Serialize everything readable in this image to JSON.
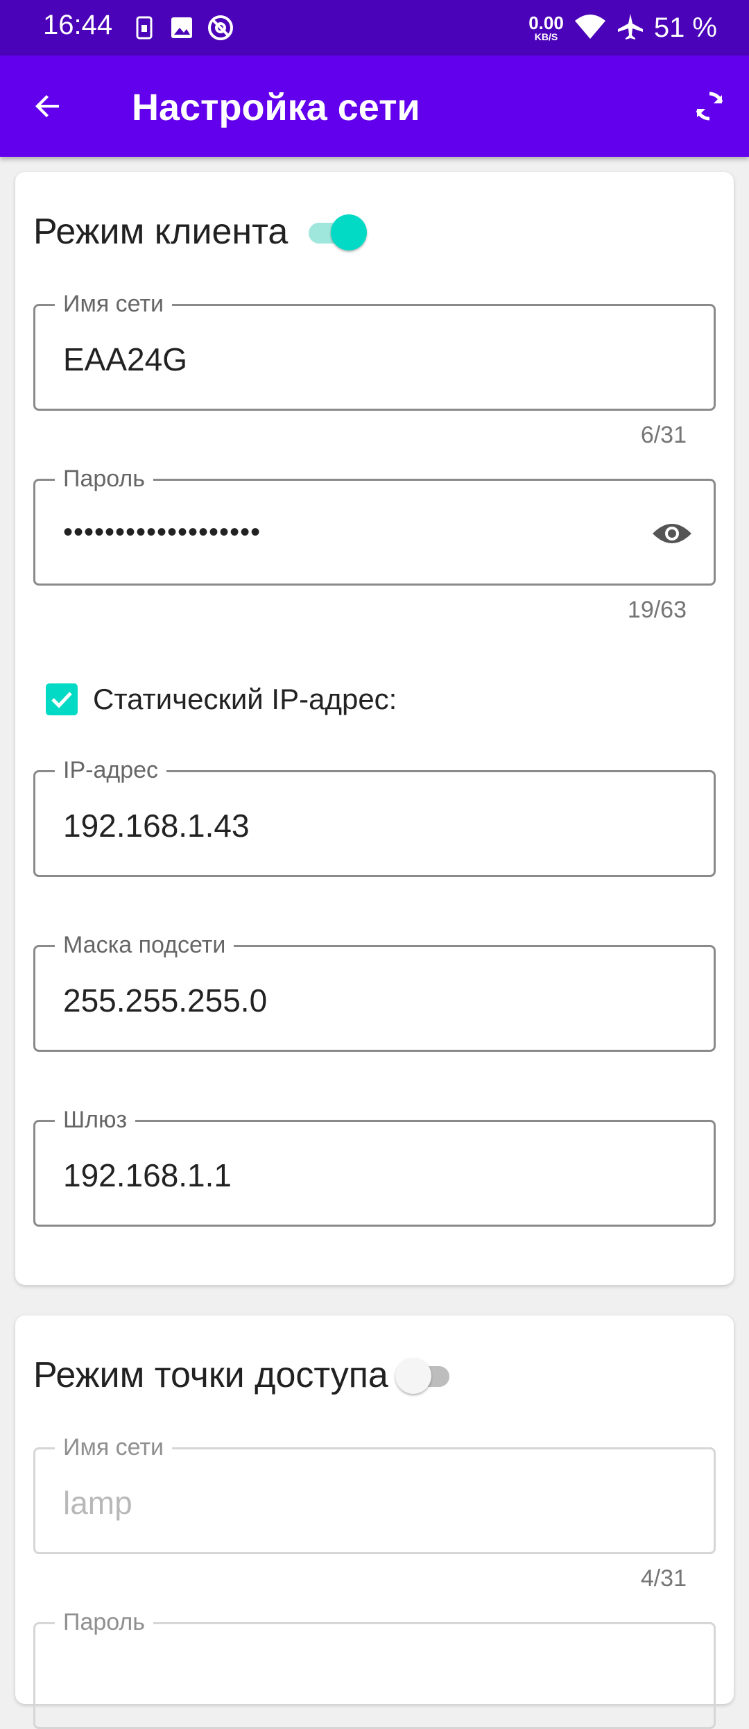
{
  "status_bar": {
    "time": "16:44",
    "speed_value": "0.00",
    "speed_unit": "KB/S",
    "battery": "51 %"
  },
  "app_bar": {
    "title": "Настройка сети"
  },
  "client_mode": {
    "title": "Режим клиента",
    "enabled": true,
    "ssid": {
      "label": "Имя сети",
      "value": "EAA24G",
      "counter": "6/31"
    },
    "password": {
      "label": "Пароль",
      "value": "•••••••••••••••••••",
      "counter": "19/63"
    },
    "static_ip": {
      "label": "Статический IP-адрес:",
      "checked": true
    },
    "ip": {
      "label": "IP-адрес",
      "value": "192.168.1.43"
    },
    "mask": {
      "label": "Маска подсети",
      "value": "255.255.255.0"
    },
    "gateway": {
      "label": "Шлюз",
      "value": "192.168.1.1"
    }
  },
  "ap_mode": {
    "title": "Режим точки доступа",
    "enabled": false,
    "ssid": {
      "label": "Имя сети",
      "value": "lamp",
      "counter": "4/31"
    },
    "password": {
      "label": "Пароль"
    }
  },
  "colors": {
    "status_bar": "#4a03b8",
    "app_bar": "#6200ee",
    "accent": "#03dac5"
  }
}
